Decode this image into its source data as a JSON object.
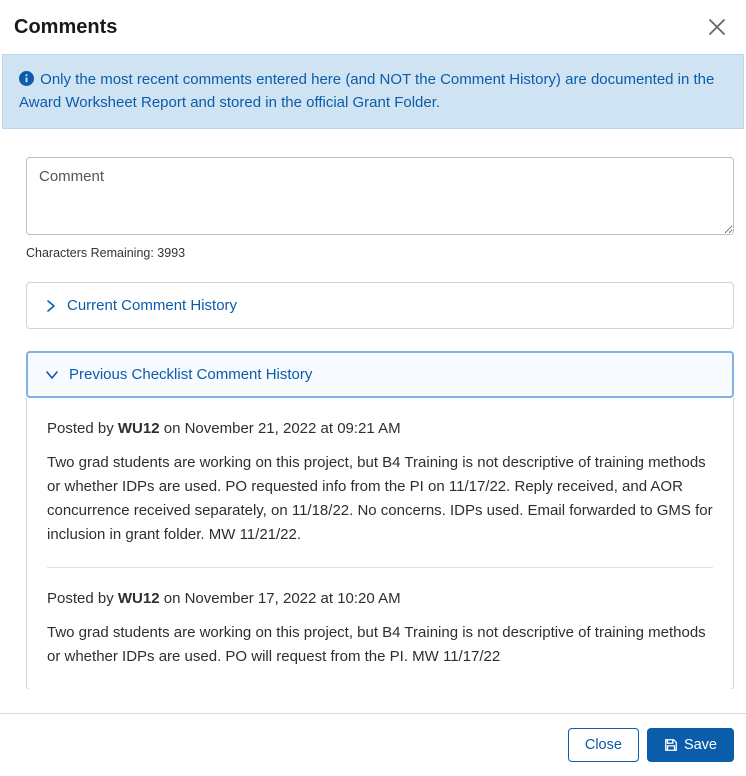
{
  "header": {
    "title": "Comments"
  },
  "banner": {
    "text": "Only the most recent comments entered here (and NOT the Comment History) are documented in the Award Worksheet Report and stored in the official Grant Folder."
  },
  "commentInput": {
    "placeholder": "Comment",
    "charLabel": "Characters Remaining: 3993"
  },
  "accordions": {
    "current": {
      "label": "Current Comment History"
    },
    "previous": {
      "label": "Previous Checklist Comment History"
    }
  },
  "history": [
    {
      "prefix": "Posted by ",
      "author": "WU12",
      "suffix": " on November 21, 2022 at 09:21 AM",
      "body": "Two grad students are working on this project, but B4 Training is not descriptive of training methods or whether IDPs are used. PO requested info from the PI on 11/17/22. Reply received, and AOR concurrence received separately, on 11/18/22. No concerns. IDPs used. Email forwarded to GMS for inclusion in grant folder. MW 11/21/22."
    },
    {
      "prefix": "Posted by ",
      "author": "WU12",
      "suffix": " on November 17, 2022 at 10:20 AM",
      "body": "Two grad students are working on this project, but B4 Training is not descriptive of training methods or whether IDPs are used. PO will request from the PI. MW 11/17/22"
    }
  ],
  "footer": {
    "close": "Close",
    "save": "Save"
  }
}
